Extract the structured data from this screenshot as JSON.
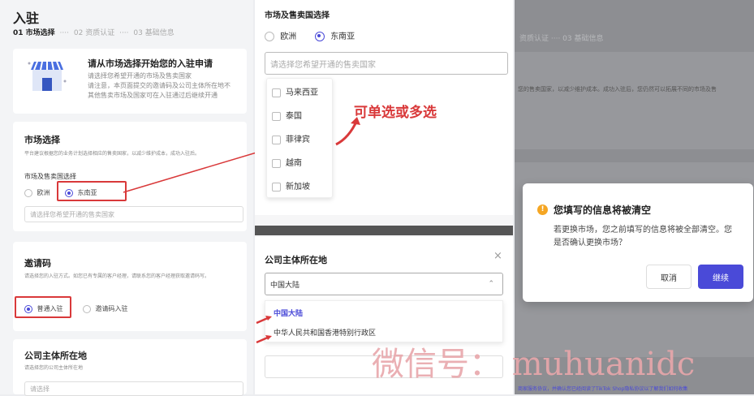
{
  "left": {
    "page_title": "入驻",
    "steps": [
      "01 市场选择",
      "02 资质认证",
      "03 基础信息"
    ],
    "step_sep": "····",
    "intro": {
      "title": "请从市场选择开始您的入驻申请",
      "lines": [
        "请选择您希望开通的市场及售卖国家",
        "请注意，本页面提交的邀请码及公司主体所在地不",
        "其他售卖市场及国家可在入驻通过后继续开通"
      ]
    },
    "market": {
      "title": "市场选择",
      "desc": "平台建议根据您的业务计划选择相应的售卖国家，以减少维护成本，成功入驻后。",
      "region_label": "市场及售卖国选择",
      "options": [
        "欧洲",
        "东南亚"
      ],
      "placeholder": "请选择您希望开通的售卖国家"
    },
    "invite": {
      "title": "邀请码",
      "desc": "请选择您的入驻方式。如您已有专属的客户经理，请联系您的客户经理获取邀请码写。",
      "options": [
        "普通入驻",
        "邀请码入驻"
      ]
    },
    "company": {
      "title": "公司主体所在地",
      "desc": "请选择您的公司主体所在地",
      "placeholder": "请选择"
    }
  },
  "mid": {
    "region_label": "市场及售卖国选择",
    "options": [
      "欧洲",
      "东南亚"
    ],
    "placeholder": "请选择您希望开通的售卖国家",
    "countries": [
      "马来西亚",
      "泰国",
      "菲律宾",
      "越南",
      "新加坡"
    ],
    "annotation": "可单选或多选",
    "company_title": "公司主体所在地",
    "company_value": "中国大陆",
    "company_options": [
      "中国大陆",
      "中华人民共和国香港特别行政区"
    ]
  },
  "right": {
    "steps": "资质认证 ···· 03 基础信息",
    "bg_desc": "您的售卖国家，以减少维护成本。成功入驻后，您仍然可以拓展不同的市场及售",
    "dialog": {
      "title": "您填写的信息将被清空",
      "body": "若更换市场，您之前填写的信息将被全部清空。您是否确认更换市场？",
      "cancel": "取消",
      "continue": "继续"
    },
    "footer_text": "商家服务协议，并确认您已经阅读了TikTok Shop隐私协议以了解我们如何收集"
  },
  "watermark": "微信号： muhuanidc",
  "colors": {
    "accent": "#4a4ad8",
    "red": "#d9393a",
    "warning": "#f5a623"
  }
}
